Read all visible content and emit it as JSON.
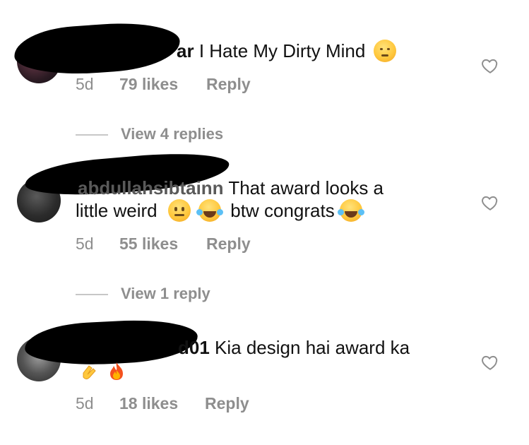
{
  "comments": [
    {
      "username_visible": "ar",
      "text": "I Hate My Dirty Mind",
      "emoji": "unamused-face",
      "time": "5d",
      "likes": "79 likes",
      "reply": "Reply",
      "view_replies": "View 4 replies"
    },
    {
      "username_visible": "abdullahsibtainn",
      "text_line1": "That award looks a",
      "text_line2a": "little weird",
      "text_line2b": "btw congrats",
      "emojis": [
        "neutral-face",
        "tears-of-joy",
        "tears-of-joy"
      ],
      "time": "5d",
      "likes": "55 likes",
      "reply": "Reply",
      "view_replies": "View 1 reply"
    },
    {
      "username_visible": "d01",
      "text": "Kia design hai award ka",
      "emojis": [
        "clap-hands",
        "fire"
      ],
      "time": "5d",
      "likes": "18 likes",
      "reply": "Reply"
    }
  ],
  "colors": {
    "text": "#111111",
    "meta": "#8e8e8e",
    "emoji": "#ffc83d"
  }
}
